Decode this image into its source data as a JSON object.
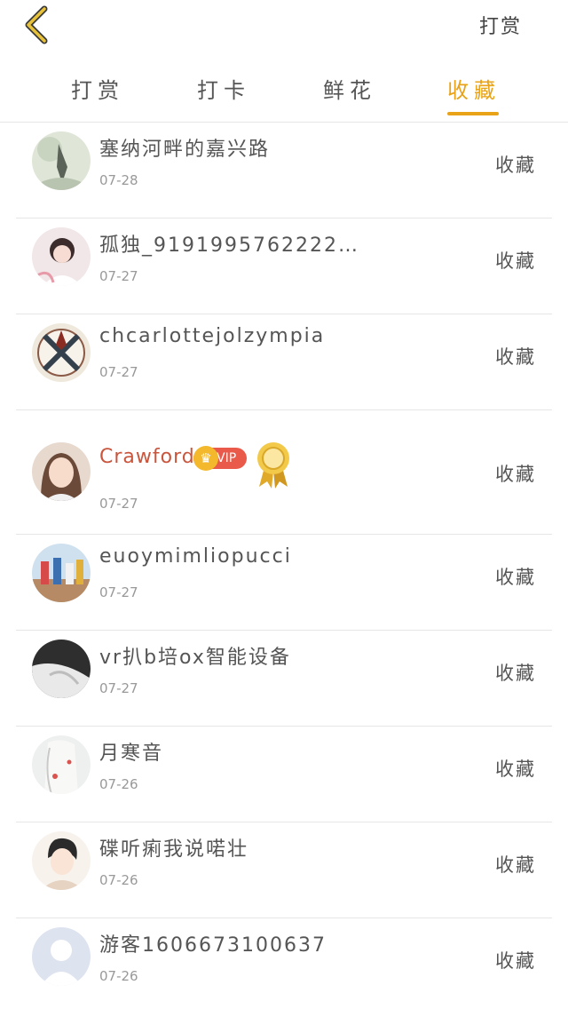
{
  "header": {
    "back_icon": "chevron-left-icon",
    "action_label": "打赏"
  },
  "tabs": [
    {
      "label": "打赏",
      "active": false
    },
    {
      "label": "打卡",
      "active": false
    },
    {
      "label": "鲜花",
      "active": false
    },
    {
      "label": "收藏",
      "active": true
    }
  ],
  "colors": {
    "accent": "#e8a318",
    "vip_name": "#c9553d",
    "vip_badge": "#ea5a4a",
    "divider": "#e6e6e6"
  },
  "list": [
    {
      "name": "塞纳河畔的嘉兴路",
      "date": "07-28",
      "action": "收藏"
    },
    {
      "name": "孤独_9191995762222…",
      "date": "07-27",
      "action": "收藏"
    },
    {
      "name": "chcarlottejolzympia",
      "date": "07-27",
      "action": "收藏"
    },
    {
      "name": "Crawford",
      "date": "07-27",
      "action": "收藏",
      "vip_label": "VIP",
      "vip_icon": "crown-icon",
      "medal_icon": "medal-icon"
    },
    {
      "name": "euoymimliopucci",
      "date": "07-27",
      "action": "收藏"
    },
    {
      "name": "vr扒b培ox智能设备",
      "date": "07-27",
      "action": "收藏"
    },
    {
      "name": "月寒音",
      "date": "07-26",
      "action": "收藏"
    },
    {
      "name": "碟听痢我说喏壮",
      "date": "07-26",
      "action": "收藏"
    },
    {
      "name": "游客1606673100637",
      "date": "07-26",
      "action": "收藏"
    }
  ]
}
